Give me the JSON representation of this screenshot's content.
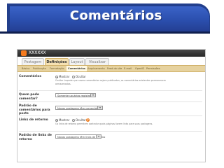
{
  "slide": {
    "title": "Comentários"
  },
  "blogger": {
    "brand": "XXXXXX",
    "tabs": [
      {
        "label": "Postagem",
        "active": false
      },
      {
        "label": "Definições",
        "active": true
      },
      {
        "label": "Layout",
        "active": false
      },
      {
        "label": "Visualizar",
        "active": false
      }
    ],
    "subtabs": [
      {
        "label": "Básico",
        "active": false
      },
      {
        "label": "Publicação",
        "active": false
      },
      {
        "label": "Formatação",
        "active": false
      },
      {
        "label": "Comentários",
        "active": true
      },
      {
        "label": "Arquivamento",
        "active": false
      },
      {
        "label": "Feed do site",
        "active": false
      },
      {
        "label": "E-mail",
        "active": false
      },
      {
        "label": "OpenID",
        "active": false
      },
      {
        "label": "Permissões",
        "active": false
      }
    ],
    "settings": [
      {
        "label": "Comentários",
        "options": [
          "Mostrar",
          "Ocultar"
        ],
        "selected": "Mostrar",
        "help": "Ocultar impede que novos comentários sejam publicados; os comentários existentes permanecem armazenados."
      },
      {
        "label": "Quem pode comentar?",
        "select_value": "Somente usuários registrados"
      },
      {
        "label": "Padrão de comentários para posts",
        "select_value": "Novas postagens têm comentários"
      },
      {
        "label": "Links de retorno",
        "options": [
          "Mostrar",
          "Ocultar"
        ],
        "selected": "Mostrar",
        "help": "Os links de retorno permitem controlar quais páginas fazem links para suas postagens."
      },
      {
        "label": "Padrão de links de retorno",
        "select_value": "Novas postagens têm links de retorno"
      }
    ]
  },
  "colors": {
    "title_bar": "#2b4fae",
    "title_bar_dark": "#223f8c",
    "active_tab": "#f6e2b3",
    "subtab_bar": "#e6d29f",
    "info_icon": "#ec7a1c"
  }
}
